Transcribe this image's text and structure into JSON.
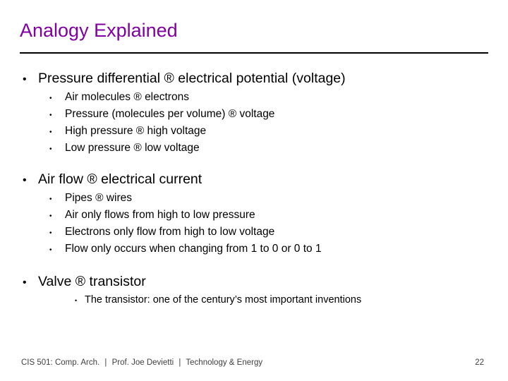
{
  "slide": {
    "title": "Analogy Explained",
    "bullet_l1": "•",
    "bullet_l2": "•",
    "bullet_l3": "•",
    "sections": [
      {
        "heading": "Pressure differential ® electrical potential (voltage)",
        "items": [
          "Air molecules ® electrons",
          "Pressure (molecules per volume) ® voltage",
          "High pressure ® high voltage",
          "Low pressure ® low voltage"
        ],
        "subitems": []
      },
      {
        "heading": "Air flow ® electrical current",
        "items": [
          "Pipes ® wires",
          "Air only flows from high to low pressure",
          "Electrons only flow from high to low voltage",
          "Flow only occurs when changing from 1 to 0 or 0 to 1"
        ],
        "subitems": []
      },
      {
        "heading": "Valve ® transistor",
        "items": [],
        "subitems": [
          "The transistor: one of the century’s most important inventions"
        ]
      }
    ]
  },
  "footer": {
    "course": "CIS 501: Comp. Arch.",
    "sep1": "|",
    "instructor": "Prof. Joe Devietti",
    "sep2": "|",
    "topic": "Technology & Energy",
    "page_number": "22"
  }
}
